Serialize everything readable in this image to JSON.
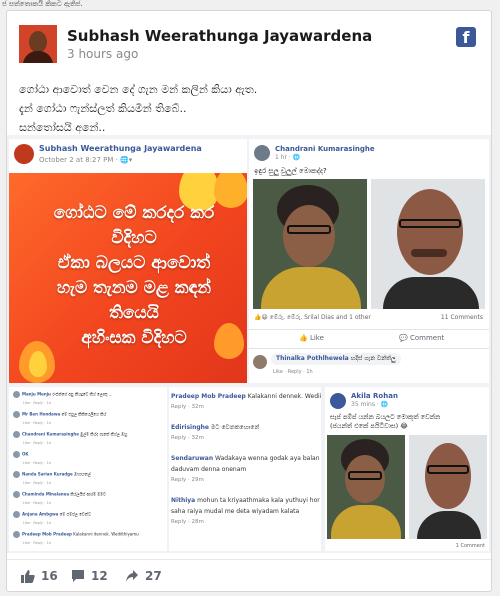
{
  "top_strip": "ජ සත්තොකයි කිකට ඇතිජ.",
  "post": {
    "author": "Subhash Weerathunga Jayawardena",
    "time": "3 hours ago",
    "text_lines": [
      "ගෝඨා ආවොත් වෙන දේ ගැන මන් කලින් කියා ඇත.",
      "දැන් ගෝඨා ෆැන්ස්ලත් කියමින් තිබේ..",
      "සන්තෝසයි අනේ.."
    ],
    "footer": {
      "likes": "16",
      "comments": "12",
      "shares": "27"
    }
  },
  "shot1": {
    "name": "Subhash Weerathunga Jayawardena",
    "time": "October 2 at 8:27 PM · 🌐▾",
    "banner_text": "ගෝඨට මේ කරදර කර\nවිදිහට\nඒකා බලයට ආවොත්\nහැම තැනම මළ කඳන්\nතියෙයි\nඅහිංසක විදිහට"
  },
  "shot2": {
    "name": "Chandrani Kumarasinghe",
    "time": "1 hr · 🌐",
    "text": "ඉඳුර සුලු චුලුල් මොකද්ද?",
    "reactions": "👍😆 මේරු, මේරු, Srilal Dias and 1 other",
    "comments": "11 Comments",
    "like": "Like",
    "comment": "Comment",
    "reply_name": "Thinalka Pothlhewela",
    "reply_text": "හදිස් ගැන වන්ත්ලු",
    "reply_meta": "Like · Reply · 1h"
  },
  "shot3": {
    "comments": [
      {
        "name": "Manju Menju",
        "text": "රංජන්ගේ අපු කියදුටේ කිය් ලොකු ..."
      },
      {
        "name": "Mr Ben Hondawa",
        "text": "මේ එපුල කිකියෙලියෙ කිය්"
      },
      {
        "name": "Chandrani Kumarasinghe",
        "text": "මුල්ම කිය්ද ගැනේ කිය්ල ඔහු"
      },
      {
        "name": "OK",
        "text": ""
      },
      {
        "name": "Nanda Sarian Kuradge",
        "text": "ඔහාහනල්"
      },
      {
        "name": "Chaminda Minalanea",
        "text": "කිය්ලයිස් ආශ්ම ම්මට"
      },
      {
        "name": "Anjana Ambgwa",
        "text": "මේ පම්ප්ල වෙන්ධ"
      },
      {
        "name": "Pradeep Mob Pradeep",
        "text": "Kalakanni dennek. Wediithiyamu"
      }
    ],
    "meta": "Like · Reply · 1d"
  },
  "shot4": {
    "lines": [
      {
        "type": "c",
        "name": "Pradeep Mob Pradeep",
        "text": "Kalakanni dennek. Wediithiyamu"
      },
      {
        "type": "m",
        "text": "Reply · 32m"
      },
      {
        "type": "c",
        "name": "Edirisinghe",
        "text": "මට වෙනකහොනේ"
      },
      {
        "type": "m",
        "text": "Reply · 32m"
      },
      {
        "type": "c",
        "name": "Sendaruwan",
        "text": "Wadakaya wenna godak aya balan i"
      },
      {
        "type": "t",
        "text": "daduvam denna onenam"
      },
      {
        "type": "m",
        "text": "Reply · 29m"
      },
      {
        "type": "c",
        "name": "Nithiya",
        "text": "mohun ta kriyaathmaka kala yuthuyi hor"
      },
      {
        "type": "t",
        "text": "saha raiya mudal me deta wiyadam kalata"
      },
      {
        "type": "m",
        "text": "Reply · 28m"
      }
    ]
  },
  "shot5": {
    "name": "Akila Rohan",
    "time": "35 mins · 🌐",
    "text": "සැප් පම්ප් යන්න බයලට මොකුත් වෙන්න\n(ජයන්ත් එකේ පයිටිවාස) 😂",
    "comments": "1 Comment"
  }
}
